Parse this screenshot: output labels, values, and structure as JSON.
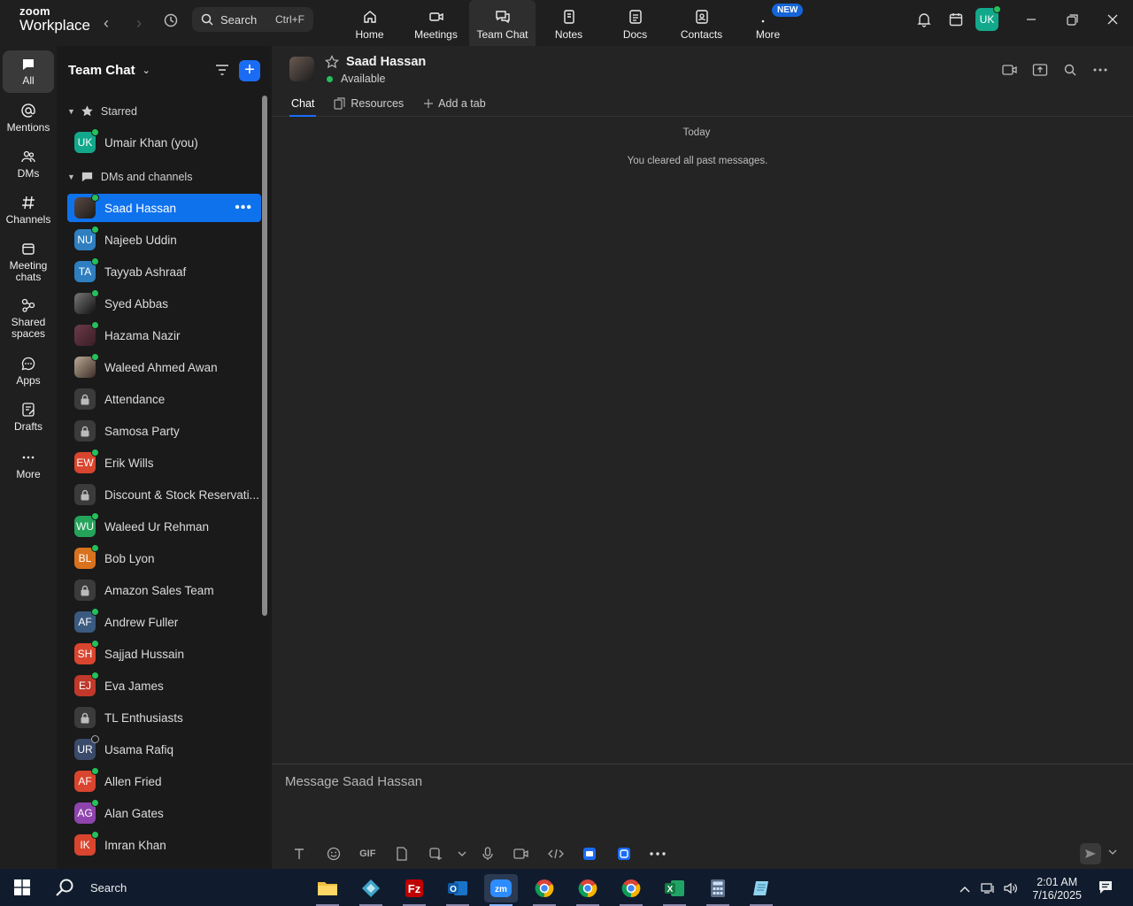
{
  "app": {
    "logo_line1": "zoom",
    "logo_line2": "Workplace"
  },
  "search": {
    "label": "Search",
    "shortcut": "Ctrl+F"
  },
  "tabs": [
    {
      "label": "Home",
      "icon": "home-icon"
    },
    {
      "label": "Meetings",
      "icon": "video-camera-icon"
    },
    {
      "label": "Team Chat",
      "icon": "chat-bubbles-icon"
    },
    {
      "label": "Notes",
      "icon": "notes-icon"
    },
    {
      "label": "Docs",
      "icon": "docs-icon"
    },
    {
      "label": "Contacts",
      "icon": "contacts-icon"
    },
    {
      "label": "More",
      "icon": "more-dots-icon",
      "badge": "NEW"
    }
  ],
  "user": {
    "initials": "UK"
  },
  "rail": [
    {
      "label": "All"
    },
    {
      "label": "Mentions"
    },
    {
      "label": "DMs"
    },
    {
      "label": "Channels"
    },
    {
      "label": "Meeting chats"
    },
    {
      "label": "Shared spaces"
    },
    {
      "label": "Apps"
    },
    {
      "label": "Drafts"
    },
    {
      "label": "More"
    }
  ],
  "sidebar": {
    "title": "Team Chat",
    "starred_label": "Starred",
    "dms_label": "DMs and channels",
    "starred": [
      {
        "name": "Umair Khan (you)",
        "initials": "UK",
        "color": "#12a88b",
        "status": "online"
      }
    ],
    "items": [
      {
        "name": "Saad Hassan",
        "initials": "",
        "color": "photo",
        "status": "online"
      },
      {
        "name": "Najeeb Uddin",
        "initials": "NU",
        "color": "#2f7fc0",
        "status": "online"
      },
      {
        "name": "Tayyab Ashraaf",
        "initials": "TA",
        "color": "#2f7fc0",
        "status": "online"
      },
      {
        "name": "Syed Abbas",
        "initials": "",
        "color": "photo4",
        "status": "online"
      },
      {
        "name": "Hazama Nazir",
        "initials": "",
        "color": "photo2",
        "status": "online"
      },
      {
        "name": "Waleed Ahmed Awan",
        "initials": "",
        "color": "photo3",
        "status": "online"
      },
      {
        "name": "Attendance",
        "initials": "",
        "color": "lock",
        "status": "none"
      },
      {
        "name": "Samosa Party",
        "initials": "",
        "color": "lock",
        "status": "none"
      },
      {
        "name": "Erik Wills",
        "initials": "EW",
        "color": "#d9452e",
        "status": "online"
      },
      {
        "name": "Discount & Stock Reservati...",
        "initials": "",
        "color": "lock",
        "status": "none"
      },
      {
        "name": "Waleed Ur Rehman",
        "initials": "WU",
        "color": "#25a35a",
        "status": "online"
      },
      {
        "name": "Bob Lyon",
        "initials": "BL",
        "color": "#d9721e",
        "status": "online"
      },
      {
        "name": "Amazon Sales Team",
        "initials": "",
        "color": "lock",
        "status": "none"
      },
      {
        "name": "Andrew Fuller",
        "initials": "AF",
        "color": "#3a5a80",
        "status": "online"
      },
      {
        "name": "Sajjad Hussain",
        "initials": "SH",
        "color": "#d9452e",
        "status": "online"
      },
      {
        "name": "Eva James",
        "initials": "EJ",
        "color": "#c0392b",
        "status": "online"
      },
      {
        "name": "TL Enthusiasts",
        "initials": "",
        "color": "lock",
        "status": "none"
      },
      {
        "name": "Usama Rafiq",
        "initials": "UR",
        "color": "#3a4a6a",
        "status": "offline"
      },
      {
        "name": "Allen Fried",
        "initials": "AF",
        "color": "#d9452e",
        "status": "online"
      },
      {
        "name": "Alan Gates",
        "initials": "AG",
        "color": "#8e44ad",
        "status": "online"
      },
      {
        "name": "Imran Khan",
        "initials": "IK",
        "color": "#d9452e",
        "status": "online"
      }
    ]
  },
  "chat": {
    "name": "Saad Hassan",
    "status": "Available",
    "tabs": [
      {
        "label": "Chat"
      },
      {
        "label": "Resources"
      },
      {
        "label": "Add a tab"
      }
    ],
    "date_divider": "Today",
    "system_message": "You cleared all past messages.",
    "composer_placeholder": "Message Saad Hassan"
  },
  "taskbar": {
    "search_label": "Search",
    "apps": [
      "file-explorer",
      "app-diamond",
      "filezilla",
      "outlook",
      "zoom",
      "chrome",
      "chrome",
      "chrome",
      "excel",
      "calculator",
      "notepad"
    ],
    "time": "2:01 AM",
    "date": "7/16/2025"
  },
  "colors": {
    "accent": "#0e72ed",
    "online": "#25c05a",
    "background": "#242424"
  }
}
